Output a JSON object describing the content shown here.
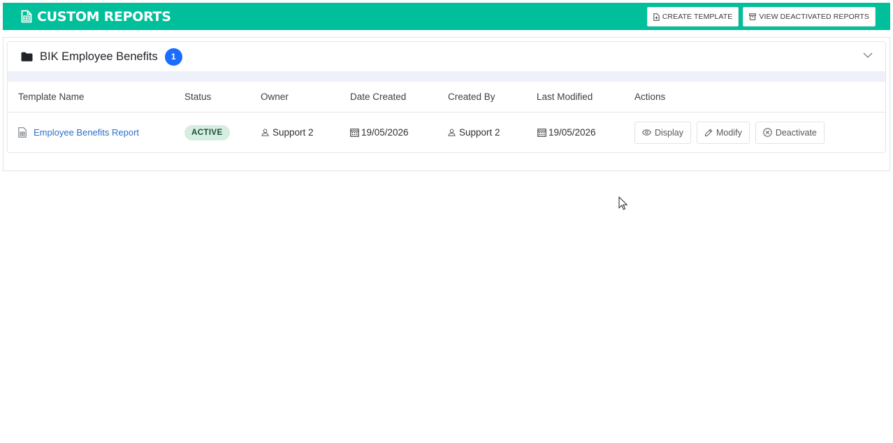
{
  "header": {
    "title": "CUSTOM REPORTS",
    "title_icon": "report-icon",
    "create_template_label": "CREATE TEMPLATE",
    "view_deactivated_label": "VIEW DEACTIVATED REPORTS",
    "bg_color": "#00bf9a"
  },
  "group": {
    "title": "BIK Employee Benefits",
    "count": "1",
    "badge_color": "#1a6dff"
  },
  "table": {
    "columns": [
      "Template Name",
      "Status",
      "Owner",
      "Date Created",
      "Created By",
      "Last Modified",
      "Actions"
    ],
    "rows": [
      {
        "template_name": "Employee Benefits Report",
        "status": "ACTIVE",
        "owner": "Support 2",
        "date_created": "19/05/2026",
        "created_by": "Support 2",
        "last_modified": "19/05/2026",
        "actions": {
          "display": "Display",
          "modify": "Modify",
          "deactivate": "Deactivate"
        }
      }
    ]
  }
}
